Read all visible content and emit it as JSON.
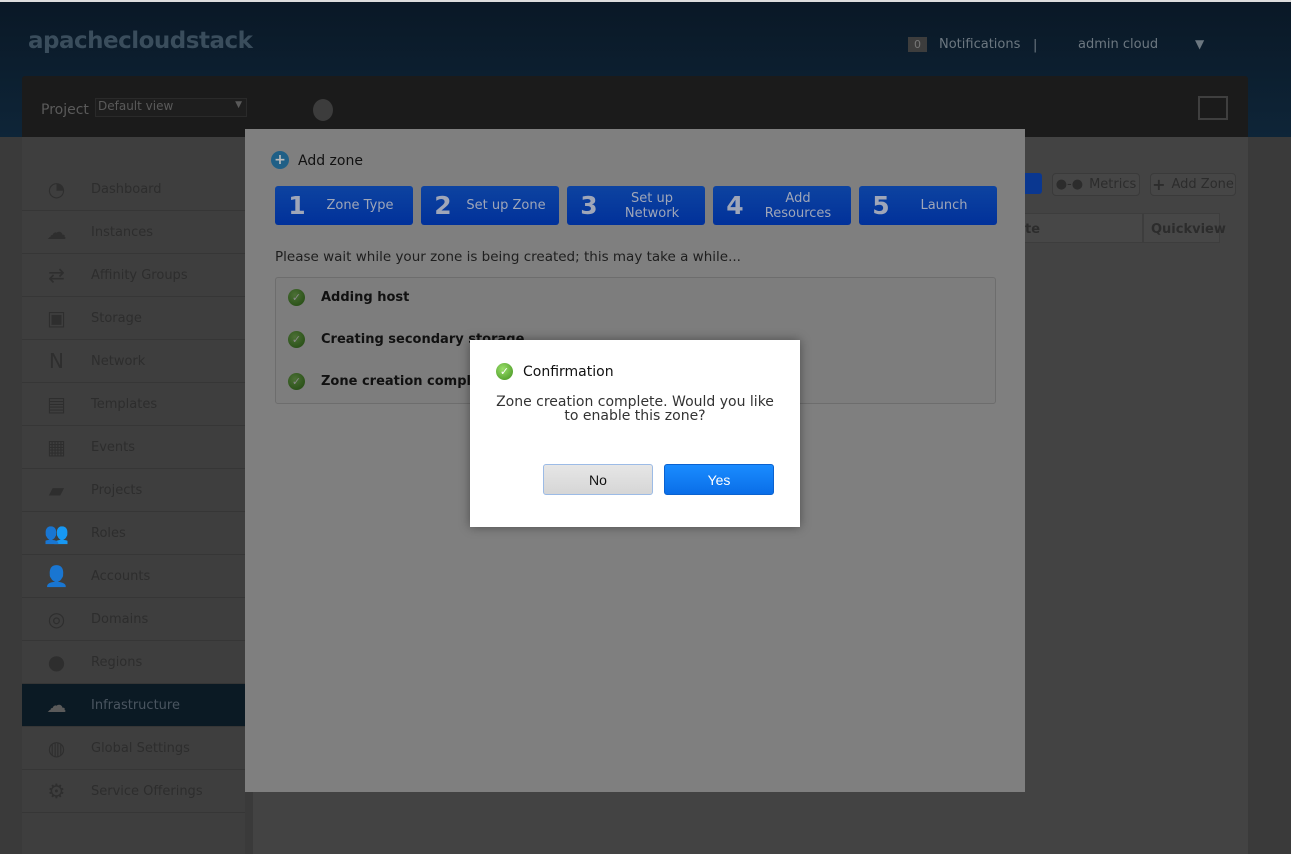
{
  "header": {
    "logo": "apachecloudstack",
    "notifications_count": "0",
    "notifications_label": "Notifications",
    "separator": "|",
    "user": "admin cloud",
    "user_menu_icon": "▼"
  },
  "topbar": {
    "project_label": "Project",
    "project_select": "Default view"
  },
  "sidebar": {
    "items": [
      {
        "label": "Dashboard",
        "icon": "◔"
      },
      {
        "label": "Instances",
        "icon": "☁"
      },
      {
        "label": "Affinity Groups",
        "icon": "⇄"
      },
      {
        "label": "Storage",
        "icon": "▣"
      },
      {
        "label": "Network",
        "icon": "N"
      },
      {
        "label": "Templates",
        "icon": "▤"
      },
      {
        "label": "Events",
        "icon": "▦"
      },
      {
        "label": "Projects",
        "icon": "▰"
      },
      {
        "label": "Roles",
        "icon": "👥"
      },
      {
        "label": "Accounts",
        "icon": "👤"
      },
      {
        "label": "Domains",
        "icon": "◎"
      },
      {
        "label": "Regions",
        "icon": "●"
      },
      {
        "label": "Infrastructure",
        "icon": "☁",
        "active": true
      },
      {
        "label": "Global Settings",
        "icon": "◍"
      },
      {
        "label": "Service Offerings",
        "icon": "⚙"
      }
    ]
  },
  "main": {
    "metrics_label": "Metrics",
    "add_zone_label": "Add Zone",
    "col_partial": "te",
    "col_quickview": "Quickview"
  },
  "dialog": {
    "title": "Add zone",
    "steps": [
      {
        "num": "1",
        "label": "Zone Type"
      },
      {
        "num": "2",
        "label": "Set up Zone"
      },
      {
        "num": "3",
        "label": "Set up Network"
      },
      {
        "num": "4",
        "label": "Add Resources"
      },
      {
        "num": "5",
        "label": "Launch"
      }
    ],
    "wait_message": "Please wait while your zone is being created; this may take a while...",
    "progress": [
      "Adding host",
      "Creating secondary storage",
      "Zone creation complete"
    ]
  },
  "confirm": {
    "title": "Confirmation",
    "message": "Zone creation complete. Would you like to enable this zone?",
    "no_label": "No",
    "yes_label": "Yes"
  },
  "colors": {
    "step_blue": "#0d43a0",
    "yes_blue": "#0a7af5",
    "active_nav": "#0b1a24"
  }
}
